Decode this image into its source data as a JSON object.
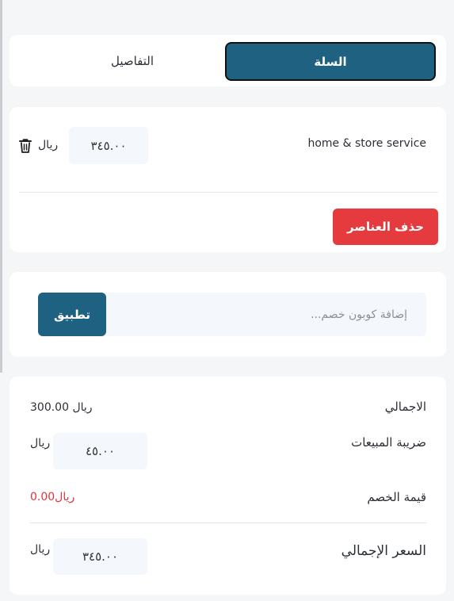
{
  "tabs": {
    "cart": "السلة",
    "details": "التفاصيل"
  },
  "cart_item": {
    "name": "home & store service",
    "price": "٣٤٥.٠٠",
    "currency": "ريال"
  },
  "delete_items_label": "حذف العناصر",
  "coupon": {
    "placeholder": "إضافة كوبون خصم...",
    "apply_label": "تطبيق"
  },
  "summary": {
    "total_label": "الاجمالي",
    "total_value": "300.00 ريال",
    "tax_label": "ضريبة المبيعات",
    "tax_value": "٤٥.٠٠",
    "tax_currency": "ريال",
    "discount_label": "قيمة الخصم",
    "discount_value": "0.00ريال",
    "grand_label": "السعر الإجمالي",
    "grand_value": "٣٤٥.٠٠",
    "grand_currency": "ريال"
  },
  "colors": {
    "primary": "#1f6180",
    "danger": "#e53b3f"
  },
  "icons": {
    "delete": "trash-icon"
  }
}
